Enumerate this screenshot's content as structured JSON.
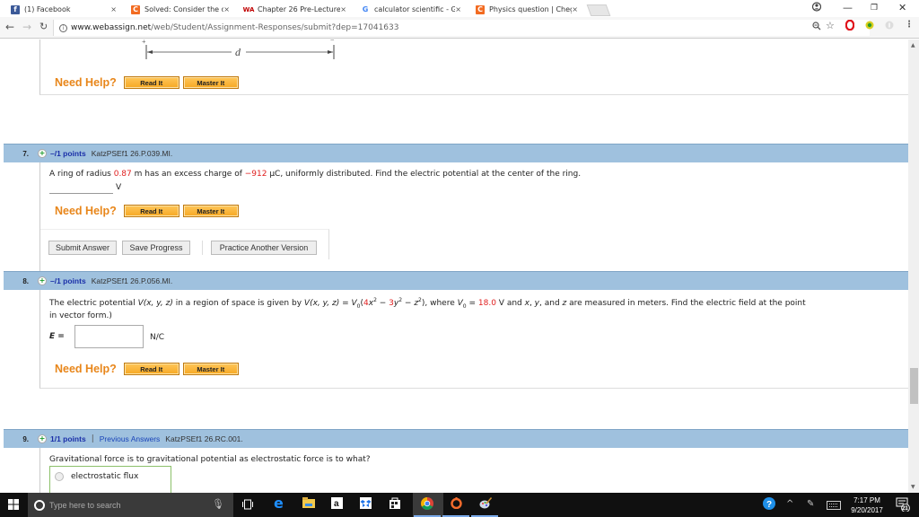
{
  "browser": {
    "tabs": [
      {
        "title": "(1) Facebook",
        "icon": "facebook-icon",
        "color": "#3b5998",
        "glyph": "f"
      },
      {
        "title": "Solved: Consider the dia",
        "icon": "chegg-icon",
        "color": "#f26b21",
        "glyph": "C"
      },
      {
        "title": "Chapter 26 Pre-Lecture",
        "icon": "webassign-icon",
        "color": "#c00000",
        "glyph": "WA",
        "active": true
      },
      {
        "title": "calculator scientific - Goo",
        "icon": "google-icon",
        "color": "#4285f4",
        "glyph": "G"
      },
      {
        "title": "Physics question | Chegg",
        "icon": "chegg-icon",
        "color": "#f26b21",
        "glyph": "C"
      }
    ],
    "close_glyph": "×",
    "url_domain": "www.webassign.net",
    "url_path": "/web/Student/Assignment-Responses/submit?dep=17041633",
    "window_controls": {
      "minimize": "—",
      "maximize": "❐",
      "close": "✕"
    }
  },
  "page": {
    "diagram": {
      "label": "d",
      "plus": "+",
      "minus": "−"
    },
    "need_help": "Need Help?",
    "read_it": "Read It",
    "master_it": "Master It",
    "questions": [
      {
        "number": "7.",
        "points": "–/1 points",
        "id": "KatzPSEf1 26.P.039.MI.",
        "text_parts": [
          "A ring of radius ",
          "0.87",
          " m has an excess charge of ",
          "−912",
          " µC, uniformly distributed. Find the electric potential at the center of the ring."
        ],
        "unit": "V",
        "buttons": {
          "submit": "Submit Answer",
          "save": "Save Progress",
          "practice": "Practice Another Version"
        }
      },
      {
        "number": "8.",
        "points": "–/1 points",
        "id": "KatzPSEf1 26.P.056.MI.",
        "text_line1": {
          "a": "The electric potential ",
          "v1": "V(x, y, z)",
          "b": " in a region of space is given by ",
          "v2": "V(x, y, z)",
          "c": " = ",
          "v0": "V",
          "sub0": "0",
          "d": "(",
          "c4": "4",
          "x2": "x",
          "e": " − ",
          "c3": "3",
          "y2": "y",
          "f": " − ",
          "z2": "z",
          "g": "),  where ",
          "h": " = ",
          "v0val": "18.0",
          "i": " V  and ",
          "xv": "x",
          "j": ", ",
          "yv": "y",
          "k": ", and ",
          "zv": "z",
          "l": " are measured in meters. Find the electric field at the point"
        },
        "text_line2": "in vector form.)",
        "field_label": "E =",
        "unit": "N/C"
      },
      {
        "number": "9.",
        "points": "1/1 points",
        "separator": "|",
        "previous_answers": "Previous Answers",
        "id": "KatzPSEf1 26.RC.001.",
        "text": "Gravitational force is to gravitational potential as electrostatic force is to what?",
        "options": [
          "electrostatic flux"
        ]
      }
    ]
  },
  "taskbar": {
    "search_placeholder": "Type here to search",
    "time": "7:17 PM",
    "date": "9/20/2017",
    "notifications": "21"
  }
}
